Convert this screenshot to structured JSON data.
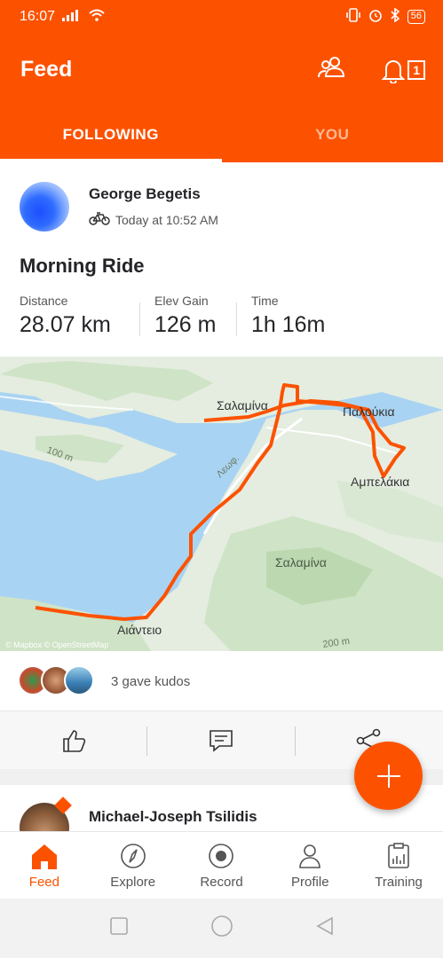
{
  "status_bar": {
    "time": "16:07",
    "battery": "56"
  },
  "header": {
    "title": "Feed",
    "notification_count": "1"
  },
  "tabs": [
    {
      "label": "FOLLOWING",
      "active": true
    },
    {
      "label": "YOU",
      "active": false
    }
  ],
  "post": {
    "athlete_name": "George Begetis",
    "timestamp": "Today at 10:52 AM",
    "activity_type_icon": "bike-icon",
    "title": "Morning Ride",
    "stats": [
      {
        "label": "Distance",
        "value": "28.07 km"
      },
      {
        "label": "Elev Gain",
        "value": "126 m"
      },
      {
        "label": "Time",
        "value": "1h 16m"
      }
    ],
    "map": {
      "labels": {
        "salamina_town": "Σαλαμίνα",
        "paloukia": "Παλούκια",
        "ampelakia": "Αμπελάκια",
        "salamina_area": "Σαλαμίνα",
        "aianteio": "Αιάντειο",
        "contour_100": "100 m",
        "contour_200": "200 m",
        "road": "Λεωφ."
      },
      "attribution": "© Mapbox © OpenStreetMap",
      "route_color": "#fc5200"
    },
    "kudos_text": "3 gave kudos"
  },
  "next_post": {
    "athlete_name": "Michael-Joseph Tsilidis"
  },
  "bottom_nav": [
    {
      "label": "Feed",
      "icon": "home-icon",
      "active": true
    },
    {
      "label": "Explore",
      "icon": "compass-icon",
      "active": false
    },
    {
      "label": "Record",
      "icon": "record-icon",
      "active": false
    },
    {
      "label": "Profile",
      "icon": "profile-icon",
      "active": false
    },
    {
      "label": "Training",
      "icon": "training-icon",
      "active": false
    }
  ],
  "colors": {
    "brand": "#fc5200",
    "water": "#a9d3f2",
    "land": "#e4ede0"
  }
}
